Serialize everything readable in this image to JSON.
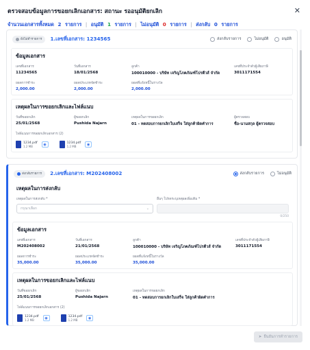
{
  "header": {
    "title": "ตรวจสอบข้อมูลการขอยกเลิกเอกสาร: สถานะ รออนุมัติยกเลิก",
    "close_icon": "close-icon"
  },
  "summary": {
    "total_label": "จำนวนเอกสารทั้งหมด",
    "total_count": "2",
    "total_unit": "รายการ",
    "approved_label": "อนุมัติ",
    "approved_count": "1",
    "approved_unit": "รายการ",
    "rejected_label": "ไม่อนุมัติ",
    "rejected_count": "0",
    "rejected_unit": "รายการ",
    "returned_label": "ส่งกลับ",
    "returned_count": "0",
    "returned_unit": "รายการ"
  },
  "colors": {
    "accent": "#2563eb",
    "approved": "#16a34a",
    "rejected": "#dc2626"
  },
  "cards": [
    {
      "badge": "ยังไม่ทำรายการ",
      "doc_no": "1.เลขที่เอกสาร: 1234565",
      "options": [
        "ส่งกลับรายการ",
        "ไม่อนุมัติ",
        "อนุมัติ"
      ],
      "info": {
        "title": "ข้อมูลเอกสาร",
        "fields": [
          {
            "label": "เลขที่เอกสาร",
            "value": "11234565"
          },
          {
            "label": "วันที่เอกสาร",
            "value": "18/01/2568"
          },
          {
            "label": "ลูกค้า",
            "value": "100010000 - บริษัท เจริญโภคภัณฑ์โปรตีวส์ จำกัด"
          },
          {
            "label": "เลขที่ประจำตัวผู้เสียภาษี",
            "value": "3011171554"
          },
          {
            "label": "ยอดการชำระ",
            "value": "2,000.00"
          },
          {
            "label": "ยอดประเภทจัดชำระ",
            "value": "2,000.00"
          },
          {
            "label": "ยอดที่แจ้งหนี้ในรางวัล",
            "value": "2,000.00"
          }
        ]
      },
      "reason": {
        "title": "เหตุผลในการขอยกเลิกและไฟล์แนบ",
        "fields": [
          {
            "label": "วันที่ขอยกเลิก",
            "value": "25/01/2568"
          },
          {
            "label": "ผู้ขอยกเลิก",
            "value": "Pushida Najarn"
          },
          {
            "label": "เหตุผลในการขอยกเลิก",
            "value": "01 - ทดสอบการยกเลิกใบเสร็จ ใส่ลูกค้าผิดคำการ"
          },
          {
            "label": "ผู้ตรวจสอบ",
            "value": "ชื่อ-นามสกุล ผู้ตรวจสอบ"
          }
        ],
        "files_label": "ไฟล์แนบการขอยกเลิกเอกสาร (2)",
        "files": [
          {
            "name": "1234.pdf",
            "size": "1.2 MB"
          },
          {
            "name": "1234.pdf",
            "size": "1.2 MB"
          }
        ]
      }
    },
    {
      "badge": "ส่งกลับรายการ",
      "doc_no": "2.เลขที่เอกสาร: M202408002",
      "options": [
        "ส่งกลับรายการ",
        "ไม่อนุมัติ"
      ],
      "return": {
        "title": "เหตุผลในการส่งกลับ",
        "reason_label": "เหตุผลในการส่งกลับ *",
        "reason_placeholder": "กรุณาเลือก",
        "other_label": "อื่นๆ โปรดระบุเหตุผลเพิ่มเติม *",
        "counter": "0/250"
      },
      "info": {
        "title": "ข้อมูลเอกสาร",
        "fields": [
          {
            "label": "เลขที่เอกสาร",
            "value": "M202408002"
          },
          {
            "label": "วันที่เอกสาร",
            "value": "21/01/2568"
          },
          {
            "label": "ลูกค้า",
            "value": "100010000 - บริษัท เจริญโภคภัณฑ์โปรตีวส์ จำกัด"
          },
          {
            "label": "เลขที่ประจำตัวผู้เสียภาษี",
            "value": "3011171554"
          },
          {
            "label": "ยอดการชำระ",
            "value": "35,000.00"
          },
          {
            "label": "ยอดประเภทจัดชำระ",
            "value": "35,000.00"
          },
          {
            "label": "ยอดที่แจ้งหนี้ในรางวัล",
            "value": "35,000.00"
          }
        ]
      },
      "reason": {
        "title": "เหตุผลในการขอยกเลิกและไฟล์แนบ",
        "fields": [
          {
            "label": "วันที่ขอยกเลิก",
            "value": "25/01/2568"
          },
          {
            "label": "ผู้ขอยกเลิก",
            "value": "Pushida Najarn"
          },
          {
            "label": "เหตุผลในการขอยกเลิก",
            "value": "01 - ทดสอบการยกเลิกใบเสร็จ ใส่ลูกค้าผิดคำการ"
          }
        ],
        "files_label": "ไฟล์แนบการขอยกเลิกเอกสาร (2)",
        "files": [
          {
            "name": "1234.pdf",
            "size": "1.2 MB"
          },
          {
            "name": "1234.pdf",
            "size": "1.2 MB"
          }
        ]
      }
    }
  ],
  "footer": {
    "send_label": "ยืนยันการทำรายการ"
  }
}
